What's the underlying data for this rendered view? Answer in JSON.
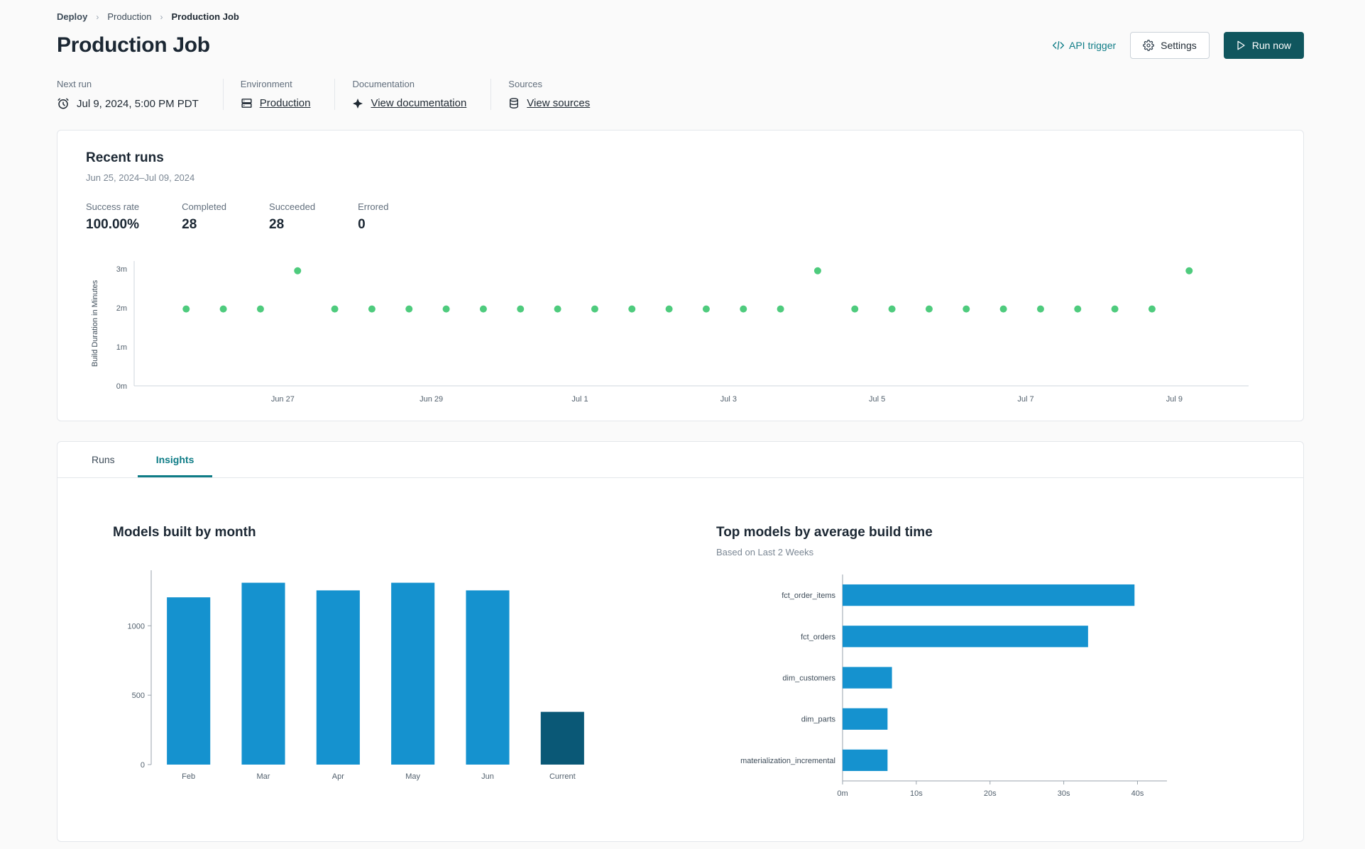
{
  "breadcrumb": {
    "separator": "›",
    "items": [
      {
        "label": "Deploy"
      },
      {
        "label": "Production"
      },
      {
        "label": "Production Job"
      }
    ]
  },
  "header": {
    "title": "Production Job",
    "api_trigger": "API trigger",
    "settings": "Settings",
    "run_now": "Run now"
  },
  "info_bar": {
    "next_run": {
      "label": "Next run",
      "value": "Jul 9, 2024, 5:00 PM PDT",
      "icon": "clock-icon"
    },
    "environment": {
      "label": "Environment",
      "value": "Production",
      "icon": "environment-icon"
    },
    "documentation": {
      "label": "Documentation",
      "value": "View documentation",
      "icon": "docs-icon"
    },
    "sources": {
      "label": "Sources",
      "value": "View sources",
      "icon": "database-icon"
    }
  },
  "recent_runs": {
    "title": "Recent runs",
    "date_range": "Jun 25, 2024–Jul 09, 2024",
    "stats": [
      {
        "label": "Success rate",
        "value": "100.00%"
      },
      {
        "label": "Completed",
        "value": "28"
      },
      {
        "label": "Succeeded",
        "value": "28"
      },
      {
        "label": "Errored",
        "value": "0"
      }
    ]
  },
  "tabs": {
    "items": [
      {
        "label": "Runs",
        "active": false
      },
      {
        "label": "Insights",
        "active": true
      }
    ]
  },
  "colors": {
    "accent_teal": "#0e7c86",
    "run_button": "#10565e",
    "success_green": "#4ecb7d",
    "bar_blue": "#1592cf",
    "bar_dark": "#0a5876"
  },
  "chart_data": [
    {
      "type": "scatter",
      "ylabel": "Build Duration in Minutes",
      "xlim": [
        0,
        15
      ],
      "ylim": [
        0,
        3.2
      ],
      "yticks": [
        {
          "value": 0,
          "label": "0m"
        },
        {
          "value": 1,
          "label": "1m"
        },
        {
          "value": 2,
          "label": "2m"
        },
        {
          "value": 3,
          "label": "3m"
        }
      ],
      "xticks": [
        {
          "value": 2,
          "label": "Jun 27"
        },
        {
          "value": 4,
          "label": "Jun 29"
        },
        {
          "value": 6,
          "label": "Jul 1"
        },
        {
          "value": 8,
          "label": "Jul 3"
        },
        {
          "value": 10,
          "label": "Jul 5"
        },
        {
          "value": 12,
          "label": "Jul 7"
        },
        {
          "value": 14,
          "label": "Jul 9"
        }
      ],
      "point_color": "#4ecb7d",
      "points": [
        {
          "x": 0.7,
          "y": 1.97
        },
        {
          "x": 1.2,
          "y": 1.97
        },
        {
          "x": 1.7,
          "y": 1.97
        },
        {
          "x": 2.2,
          "y": 2.95
        },
        {
          "x": 2.7,
          "y": 1.97
        },
        {
          "x": 3.2,
          "y": 1.97
        },
        {
          "x": 3.7,
          "y": 1.97
        },
        {
          "x": 4.2,
          "y": 1.97
        },
        {
          "x": 4.7,
          "y": 1.97
        },
        {
          "x": 5.2,
          "y": 1.97
        },
        {
          "x": 5.7,
          "y": 1.97
        },
        {
          "x": 6.2,
          "y": 1.97
        },
        {
          "x": 6.7,
          "y": 1.97
        },
        {
          "x": 7.2,
          "y": 1.97
        },
        {
          "x": 7.7,
          "y": 1.97
        },
        {
          "x": 8.2,
          "y": 1.97
        },
        {
          "x": 8.7,
          "y": 1.97
        },
        {
          "x": 9.2,
          "y": 2.95
        },
        {
          "x": 9.7,
          "y": 1.97
        },
        {
          "x": 10.2,
          "y": 1.97
        },
        {
          "x": 10.7,
          "y": 1.97
        },
        {
          "x": 11.2,
          "y": 1.97
        },
        {
          "x": 11.7,
          "y": 1.97
        },
        {
          "x": 12.2,
          "y": 1.97
        },
        {
          "x": 12.7,
          "y": 1.97
        },
        {
          "x": 13.2,
          "y": 1.97
        },
        {
          "x": 13.7,
          "y": 1.97
        },
        {
          "x": 14.2,
          "y": 2.95
        }
      ]
    },
    {
      "type": "bar",
      "title": "Models built by month",
      "categories": [
        "Feb",
        "Mar",
        "Apr",
        "May",
        "Jun",
        "Current"
      ],
      "values": [
        1205,
        1310,
        1255,
        1310,
        1255,
        380
      ],
      "bar_colors": [
        "#1592cf",
        "#1592cf",
        "#1592cf",
        "#1592cf",
        "#1592cf",
        "#0a5876"
      ],
      "ylim": [
        0,
        1400
      ],
      "yticks": [
        0,
        500,
        1000
      ]
    },
    {
      "type": "horizontal_bar",
      "title": "Top models by average build time",
      "subtitle": "Based on Last 2 Weeks",
      "categories": [
        "fct_order_items",
        "fct_orders",
        "dim_customers",
        "dim_parts",
        "materialization_incremental"
      ],
      "values": [
        39.6,
        33.3,
        6.7,
        6.1,
        6.1
      ],
      "xlim": [
        0,
        44
      ],
      "xticks": [
        {
          "value": 0,
          "label": "0m"
        },
        {
          "value": 10,
          "label": "10s"
        },
        {
          "value": 20,
          "label": "20s"
        },
        {
          "value": 30,
          "label": "30s"
        },
        {
          "value": 40,
          "label": "40s"
        }
      ],
      "bar_color": "#1592cf"
    }
  ]
}
